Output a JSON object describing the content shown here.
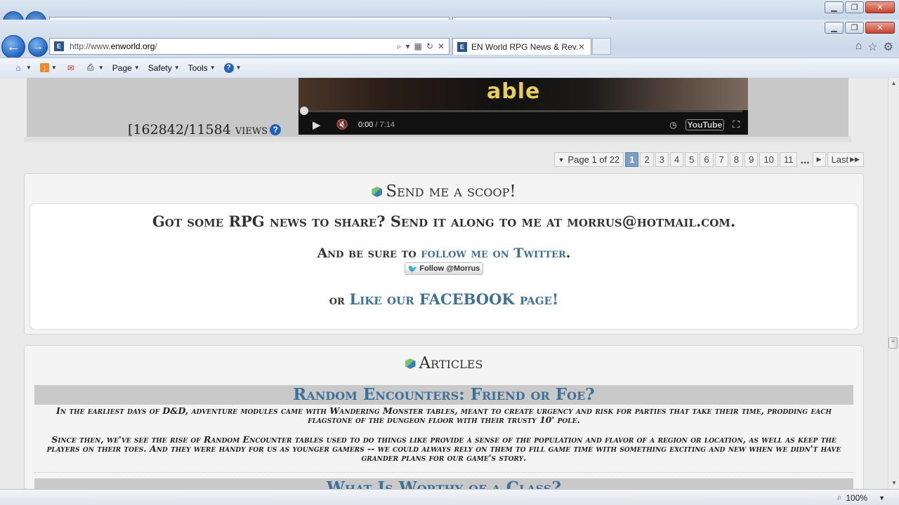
{
  "browser": {
    "url_prefix": "http://www.",
    "url_domain": "enworld.org",
    "url_suffix": "/",
    "tab_title": "EN World RPG News & Rev...",
    "commands": [
      "Page",
      "Safety",
      "Tools"
    ],
    "zoom": "100%"
  },
  "video": {
    "views": "[162842/11584 views",
    "sign_text": "able",
    "time_current": "0:00",
    "time_total": " / 7:14",
    "brand": "YouTube"
  },
  "pager": {
    "label": "Page 1 of 22",
    "pages": [
      "1",
      "2",
      "3",
      "4",
      "5",
      "6",
      "7",
      "8",
      "9",
      "10",
      "11"
    ],
    "ellipsis": "...",
    "last": "Last"
  },
  "scoop": {
    "title": "Send me a scoop!",
    "line1": "Got some RPG news to share? Send it along to me at morrus@hotmail.com.",
    "line2_prefix": "And be sure to ",
    "line2_link": "follow me on Twitter",
    "line2_suffix": ".",
    "follow_button": "Follow @Morrus",
    "line3_prefix": "or ",
    "line3_link": "Like our FACEBOOK page!"
  },
  "articles": {
    "title": "Articles",
    "items": [
      {
        "title": "Random Encounters: Friend or Foe?",
        "para1": "In the earliest days of D&D, adventure modules came with Wandering Monster tables, meant to create urgency and risk for parties that take their time, prodding each flagstone of the dungeon floor with their trusty 10' pole.",
        "para2": "Since then, we've see the rise of Random Encounter tables used to do things like provide a sense of the population and flavor of a region or location, as well as keep the players on their toes. And they were handy for us as younger gamers -- we could always rely on them to fill game time with something exciting and new when we didn't have grander plans for our game's story."
      },
      {
        "title": "What Is Worthy of a Class?"
      }
    ]
  }
}
